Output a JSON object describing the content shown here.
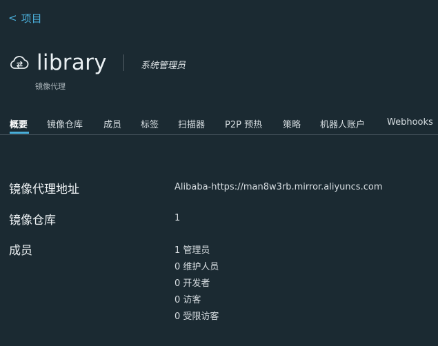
{
  "nav": {
    "back_chevron": "<",
    "back_label": "项目"
  },
  "project": {
    "name": "library",
    "role": "系统管理员",
    "subtitle": "镜像代理",
    "icon": "cloud-sync-icon"
  },
  "tabs": [
    {
      "label": "概要",
      "active": true
    },
    {
      "label": "镜像仓库",
      "active": false
    },
    {
      "label": "成员",
      "active": false
    },
    {
      "label": "标签",
      "active": false
    },
    {
      "label": "扫描器",
      "active": false
    },
    {
      "label": "P2P 预热",
      "active": false
    },
    {
      "label": "策略",
      "active": false
    },
    {
      "label": "机器人账户",
      "active": false
    },
    {
      "label": "Webhooks",
      "active": false
    }
  ],
  "summary": {
    "proxy_label": "镜像代理地址",
    "proxy_value": "Alibaba-https://man8w3rb.mirror.aliyuncs.com",
    "repo_label": "镜像仓库",
    "repo_value": "1",
    "members_label": "成员",
    "members": [
      "1 管理员",
      "0 维护人员",
      "0 开发者",
      "0 访客",
      "0 受限访客"
    ]
  },
  "colors": {
    "background": "#1b2a32",
    "accent": "#4aaed9"
  }
}
